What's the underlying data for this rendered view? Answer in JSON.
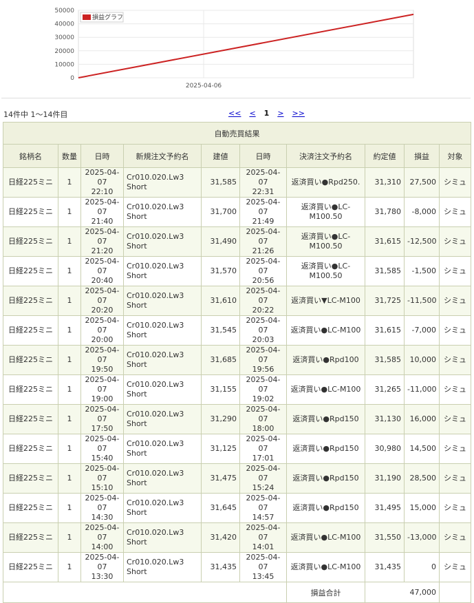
{
  "chart_data": {
    "type": "line",
    "legend": "損益グラフ",
    "x_tick_labels": [
      "2025-04-06"
    ],
    "y_ticks": [
      0,
      10000,
      20000,
      30000,
      40000,
      50000
    ],
    "ylim": [
      0,
      50000
    ],
    "series": [
      {
        "name": "損益グラフ",
        "color": "#cc2222",
        "values": [
          0,
          47000
        ]
      }
    ],
    "grid": true
  },
  "list": {
    "count_text": "14件中 1〜14件目",
    "pager": {
      "first": "<<",
      "prev": "<",
      "current": "1",
      "next": ">",
      "last": ">>"
    }
  },
  "table": {
    "title": "自動売買結果",
    "headers": [
      "銘柄名",
      "数量",
      "日時",
      "新規注文予約名",
      "建値",
      "日時",
      "決済注文予約名",
      "約定値",
      "損益",
      "対象"
    ],
    "rows": [
      {
        "name": "日経225ミニ",
        "qty": "1",
        "open_date": "2025-04-07",
        "open_time": "22:10",
        "order": "Cr010.020.Lw3 Short",
        "price": "31,585",
        "close_date": "2025-04-07",
        "close_time": "22:31",
        "exit": "返済買い●Rpd250.",
        "fill": "31,310",
        "pl": "27,500",
        "pl_sign": "pos",
        "target": "シミュ"
      },
      {
        "name": "日経225ミニ",
        "qty": "1",
        "open_date": "2025-04-07",
        "open_time": "21:40",
        "order": "Cr010.020.Lw3 Short",
        "price": "31,700",
        "close_date": "2025-04-07",
        "close_time": "21:49",
        "exit": "返済買い●LC-M100.50",
        "fill": "31,780",
        "pl": "-8,000",
        "pl_sign": "neg",
        "target": "シミュ"
      },
      {
        "name": "日経225ミニ",
        "qty": "1",
        "open_date": "2025-04-07",
        "open_time": "21:20",
        "order": "Cr010.020.Lw3 Short",
        "price": "31,490",
        "close_date": "2025-04-07",
        "close_time": "21:26",
        "exit": "返済買い●LC-M100.50",
        "fill": "31,615",
        "pl": "-12,500",
        "pl_sign": "neg",
        "target": "シミュ"
      },
      {
        "name": "日経225ミニ",
        "qty": "1",
        "open_date": "2025-04-07",
        "open_time": "20:40",
        "order": "Cr010.020.Lw3 Short",
        "price": "31,570",
        "close_date": "2025-04-07",
        "close_time": "20:56",
        "exit": "返済買い●LC-M100.50",
        "fill": "31,585",
        "pl": "-1,500",
        "pl_sign": "neg",
        "target": "シミュ"
      },
      {
        "name": "日経225ミニ",
        "qty": "1",
        "open_date": "2025-04-07",
        "open_time": "20:20",
        "order": "Cr010.020.Lw3 Short",
        "price": "31,610",
        "close_date": "2025-04-07",
        "close_time": "20:22",
        "exit": "返済買い▼LC-M100",
        "fill": "31,725",
        "pl": "-11,500",
        "pl_sign": "neg",
        "target": "シミュ"
      },
      {
        "name": "日経225ミニ",
        "qty": "1",
        "open_date": "2025-04-07",
        "open_time": "20:00",
        "order": "Cr010.020.Lw3 Short",
        "price": "31,545",
        "close_date": "2025-04-07",
        "close_time": "20:03",
        "exit": "返済買い●LC-M100",
        "fill": "31,615",
        "pl": "-7,000",
        "pl_sign": "neg",
        "target": "シミュ"
      },
      {
        "name": "日経225ミニ",
        "qty": "1",
        "open_date": "2025-04-07",
        "open_time": "19:50",
        "order": "Cr010.020.Lw3 Short",
        "price": "31,685",
        "close_date": "2025-04-07",
        "close_time": "19:56",
        "exit": "返済買い●Rpd100",
        "fill": "31,585",
        "pl": "10,000",
        "pl_sign": "pos",
        "target": "シミュ"
      },
      {
        "name": "日経225ミニ",
        "qty": "1",
        "open_date": "2025-04-07",
        "open_time": "19:00",
        "order": "Cr010.020.Lw3 Short",
        "price": "31,155",
        "close_date": "2025-04-07",
        "close_time": "19:02",
        "exit": "返済買い●LC-M100",
        "fill": "31,265",
        "pl": "-11,000",
        "pl_sign": "neg",
        "target": "シミュ"
      },
      {
        "name": "日経225ミニ",
        "qty": "1",
        "open_date": "2025-04-07",
        "open_time": "17:50",
        "order": "Cr010.020.Lw3 Short",
        "price": "31,290",
        "close_date": "2025-04-07",
        "close_time": "18:00",
        "exit": "返済買い●Rpd150",
        "fill": "31,130",
        "pl": "16,000",
        "pl_sign": "pos",
        "target": "シミュ"
      },
      {
        "name": "日経225ミニ",
        "qty": "1",
        "open_date": "2025-04-07",
        "open_time": "15:40",
        "order": "Cr010.020.Lw3 Short",
        "price": "31,125",
        "close_date": "2025-04-07",
        "close_time": "17:01",
        "exit": "返済買い●Rpd150",
        "fill": "30,980",
        "pl": "14,500",
        "pl_sign": "pos",
        "target": "シミュ"
      },
      {
        "name": "日経225ミニ",
        "qty": "1",
        "open_date": "2025-04-07",
        "open_time": "15:10",
        "order": "Cr010.020.Lw3 Short",
        "price": "31,475",
        "close_date": "2025-04-07",
        "close_time": "15:24",
        "exit": "返済買い●Rpd150",
        "fill": "31,190",
        "pl": "28,500",
        "pl_sign": "pos",
        "target": "シミュ"
      },
      {
        "name": "日経225ミニ",
        "qty": "1",
        "open_date": "2025-04-07",
        "open_time": "14:30",
        "order": "Cr010.020.Lw3 Short",
        "price": "31,645",
        "close_date": "2025-04-07",
        "close_time": "14:57",
        "exit": "返済買い●Rpd150",
        "fill": "31,495",
        "pl": "15,000",
        "pl_sign": "pos",
        "target": "シミュ"
      },
      {
        "name": "日経225ミニ",
        "qty": "1",
        "open_date": "2025-04-07",
        "open_time": "14:00",
        "order": "Cr010.020.Lw3 Short",
        "price": "31,420",
        "close_date": "2025-04-07",
        "close_time": "14:01",
        "exit": "返済買い●LC-M100",
        "fill": "31,550",
        "pl": "-13,000",
        "pl_sign": "neg",
        "target": "シミュ"
      },
      {
        "name": "日経225ミニ",
        "qty": "1",
        "open_date": "2025-04-07",
        "open_time": "13:30",
        "order": "Cr010.020.Lw3 Short",
        "price": "31,435",
        "close_date": "2025-04-07",
        "close_time": "13:45",
        "exit": "返済買い●LC-M100",
        "fill": "31,435",
        "pl": "0",
        "pl_sign": "zero",
        "target": "シミュ"
      }
    ],
    "total_label": "損益合計",
    "total_value": "47,000"
  }
}
